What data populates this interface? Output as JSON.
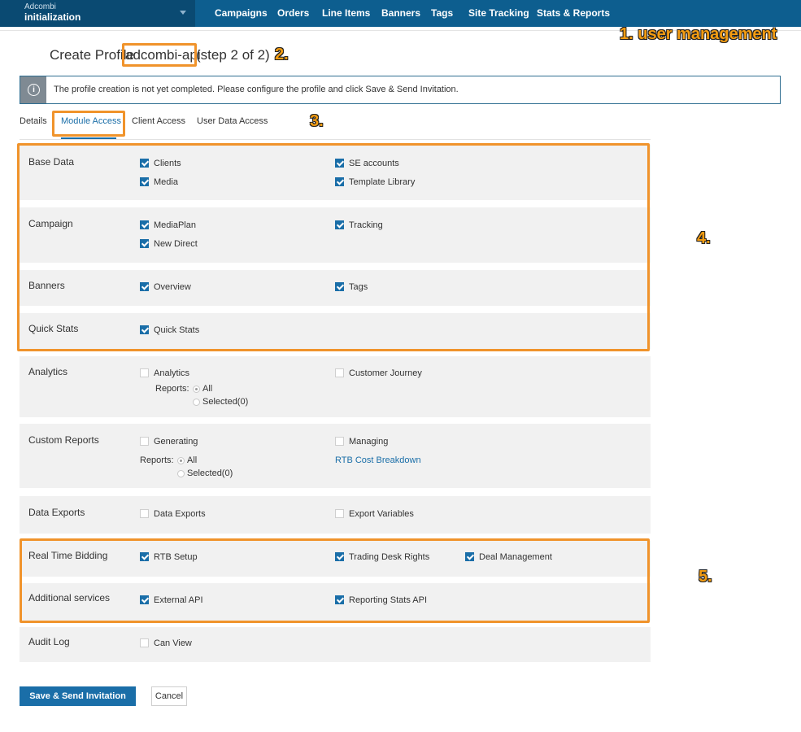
{
  "brand": {
    "small": "Adcombi",
    "big": "initialization"
  },
  "nav": [
    "Campaigns",
    "Orders",
    "Line Items",
    "Banners",
    "Tags",
    "Site Tracking",
    "Stats & Reports"
  ],
  "annotations": [
    "1. user management",
    "2.",
    "3.",
    "4.",
    "5."
  ],
  "title": {
    "prefix": "Create Profile",
    "name": "adcombi-api",
    "suffix": "(step 2 of 2)"
  },
  "info": {
    "icon": "info-icon",
    "text": "The profile creation is not yet completed. Please configure the profile and click Save & Send Invitation."
  },
  "tabs": [
    "Details",
    "Module Access",
    "Client Access",
    "User Data Access"
  ],
  "active_tab": "Module Access",
  "sections": {
    "base_data": {
      "label": "Base Data",
      "items": [
        "Clients",
        "SE accounts",
        "Media",
        "Template Library"
      ]
    },
    "campaign": {
      "label": "Campaign",
      "items": [
        "MediaPlan",
        "Tracking",
        "New Direct"
      ]
    },
    "banners": {
      "label": "Banners",
      "items": [
        "Overview",
        "Tags"
      ]
    },
    "quick_stats": {
      "label": "Quick Stats",
      "items": [
        "Quick Stats"
      ]
    },
    "analytics": {
      "label": "Analytics",
      "items": [
        "Analytics",
        "Customer Journey"
      ],
      "reports_label": "Reports:",
      "options": [
        "All",
        "Selected(0)"
      ]
    },
    "custom_reports": {
      "label": "Custom Reports",
      "items": [
        "Generating",
        "Managing"
      ],
      "reports_label": "Reports:",
      "options": [
        "All",
        "Selected(0)"
      ],
      "link": "RTB Cost Breakdown"
    },
    "data_exports": {
      "label": "Data Exports",
      "items": [
        "Data Exports",
        "Export Variables"
      ]
    },
    "rtb": {
      "label": "Real Time Bidding",
      "items": [
        "RTB Setup",
        "Trading Desk Rights",
        "Deal Management"
      ]
    },
    "additional": {
      "label": "Additional services",
      "items": [
        "External API",
        "Reporting Stats API"
      ]
    },
    "audit": {
      "label": "Audit Log",
      "items": [
        "Can View"
      ]
    }
  },
  "checked": {
    "base_data": [
      true,
      true,
      true,
      true
    ],
    "campaign": [
      true,
      true,
      true
    ],
    "banners": [
      true,
      true
    ],
    "quick_stats": [
      true
    ],
    "analytics": [
      false,
      false
    ],
    "custom_reports": [
      false,
      false
    ],
    "data_exports": [
      false,
      false
    ],
    "rtb": [
      true,
      true,
      true
    ],
    "additional": [
      true,
      true
    ],
    "audit": [
      false
    ]
  },
  "buttons": {
    "save": "Save & Send Invitation",
    "cancel": "Cancel"
  },
  "colors": {
    "topbar": "#0d5e8f",
    "brand": "#0a4a72",
    "accent": "#1a6ea8",
    "annotation": "#f39c12"
  }
}
